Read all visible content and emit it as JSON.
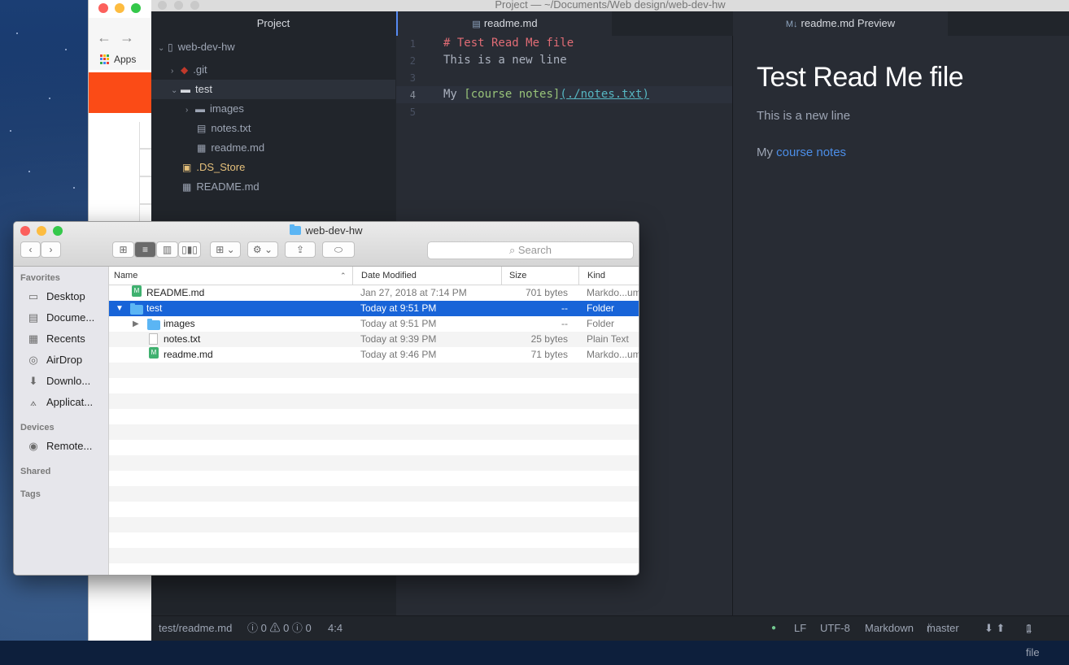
{
  "chrome": {
    "apps_label": "Apps",
    "apps_colors": [
      "#ea4335",
      "#fbbc05",
      "#34a853",
      "#4285f4",
      "#ea4335",
      "#fbbc05",
      "#34a853",
      "#4285f4",
      "#ea4335"
    ]
  },
  "atom": {
    "window_title": "Project — ~/Documents/Web design/web-dev-hw",
    "tabs": {
      "project": "Project",
      "editor": "readme.md",
      "preview": "readme.md Preview"
    },
    "tree": [
      {
        "label": "web-dev-hw",
        "type": "repo",
        "expanded": true
      },
      {
        "label": ".git",
        "type": "git",
        "expanded": false
      },
      {
        "label": "test",
        "type": "folder",
        "expanded": true,
        "selected": true
      },
      {
        "label": "images",
        "type": "folder",
        "expanded": false
      },
      {
        "label": "notes.txt",
        "type": "file"
      },
      {
        "label": "readme.md",
        "type": "markdown"
      },
      {
        "label": ".DS_Store",
        "type": "store"
      },
      {
        "label": "README.md",
        "type": "markdown"
      }
    ],
    "editor": {
      "line_numbers": [
        "1",
        "2",
        "3",
        "4",
        "5"
      ],
      "line1": "# Test Read Me file",
      "line2": "This is a new line",
      "line4_prefix": "My ",
      "line4_link_text": "[course notes]",
      "line4_paren_open": "(",
      "line4_url": "./notes.txt",
      "line4_paren_close": ")"
    },
    "preview": {
      "heading": "Test Read Me file",
      "para1": "This is a new line",
      "para2_prefix": "My ",
      "para2_link": "course notes"
    },
    "status": {
      "path": "test/readme.md",
      "diagnostics": "ⓘ 0 ⚠ 0 ⓘ 0",
      "cursor": "4:4",
      "line_ending": "LF",
      "encoding": "UTF-8",
      "grammar": "Markdown",
      "branch": "master",
      "files": "1 file"
    }
  },
  "finder": {
    "title": "web-dev-hw",
    "search_placeholder": "Search",
    "sidebar": {
      "favorites_label": "Favorites",
      "favorites": [
        "Desktop",
        "Docume...",
        "Recents",
        "AirDrop",
        "Downlo...",
        "Applicat..."
      ],
      "devices_label": "Devices",
      "devices": [
        "Remote..."
      ],
      "shared_label": "Shared",
      "tags_label": "Tags"
    },
    "columns": {
      "name": "Name",
      "date": "Date Modified",
      "size": "Size",
      "kind": "Kind"
    },
    "rows": [
      {
        "name": "README.md",
        "date": "Jan 27, 2018 at 7:14 PM",
        "size": "701 bytes",
        "kind": "Markdo...ument"
      },
      {
        "name": "test",
        "date": "Today at 9:51 PM",
        "size": "--",
        "kind": "Folder"
      },
      {
        "name": "images",
        "date": "Today at 9:51 PM",
        "size": "--",
        "kind": "Folder"
      },
      {
        "name": "notes.txt",
        "date": "Today at 9:39 PM",
        "size": "25 bytes",
        "kind": "Plain Text"
      },
      {
        "name": "readme.md",
        "date": "Today at 9:46 PM",
        "size": "71 bytes",
        "kind": "Markdo...ument"
      }
    ]
  }
}
